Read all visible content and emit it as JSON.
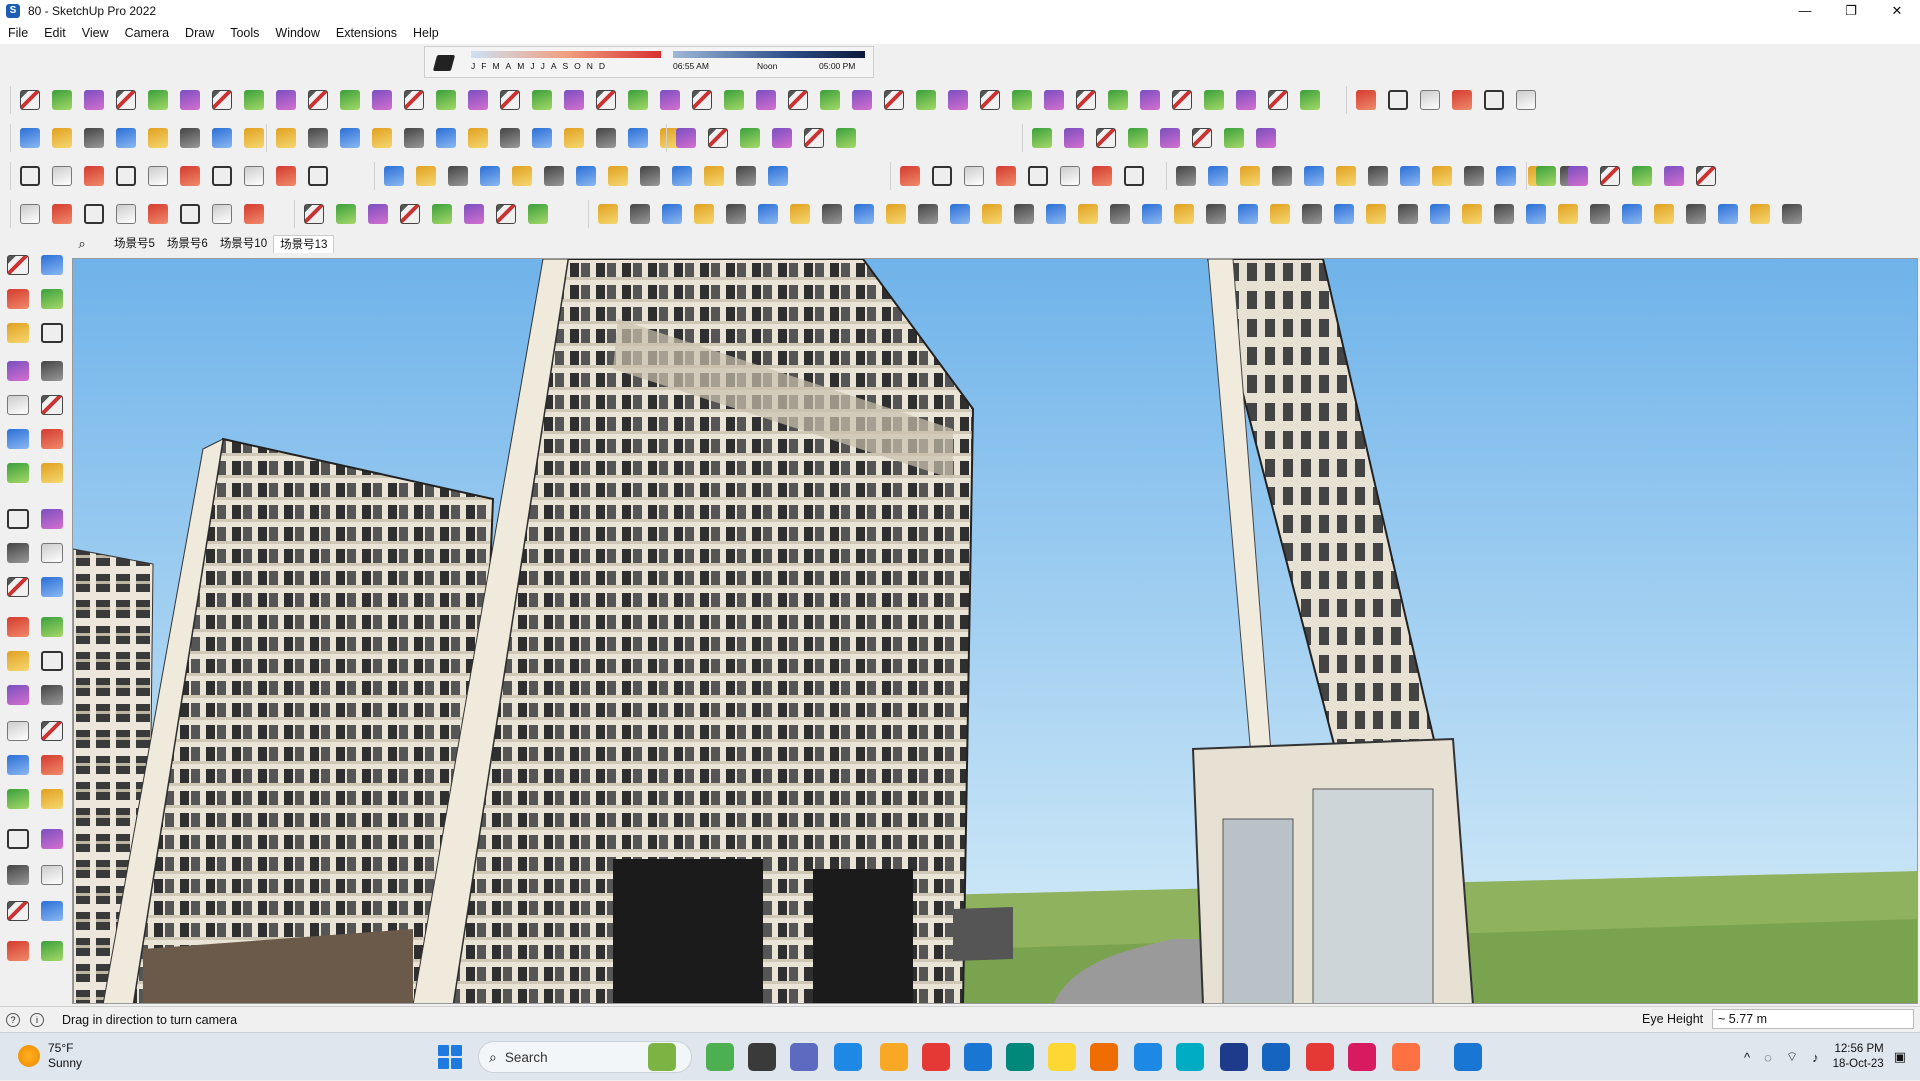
{
  "window": {
    "title": "80 - SketchUp Pro 2022",
    "app_icon": "S",
    "controls": [
      "—",
      "❐",
      "✕"
    ]
  },
  "menu": [
    "File",
    "Edit",
    "View",
    "Camera",
    "Draw",
    "Tools",
    "Window",
    "Extensions",
    "Help"
  ],
  "shadow_settings": {
    "months": [
      "J",
      "F",
      "M",
      "A",
      "M",
      "J",
      "J",
      "A",
      "S",
      "O",
      "N",
      "D"
    ],
    "time_start": "06:55 AM",
    "time_mid": "Noon",
    "time_end": "05:00 PM"
  },
  "scenes": {
    "search_icon": "search-icon",
    "tabs": [
      "场景号5",
      "场景号6",
      "场景号10",
      "场景号13"
    ],
    "active_index": 3
  },
  "status": {
    "hint": "Drag in direction to turn camera",
    "measure_label": "Eye Height",
    "measure_value": "~ 5.77 m"
  },
  "taskbar": {
    "temperature": "75°F",
    "condition": "Sunny",
    "search_placeholder": "Search",
    "time": "12:56 PM",
    "date": "18-Oct-23",
    "tray_caret": "^"
  },
  "colors": {
    "sky_top": "#7bb8e8",
    "sky_bottom": "#d8ecf8",
    "grass": "#6f9a4a",
    "facade": "#e8e2d2",
    "accent": "#1f7ae0"
  }
}
